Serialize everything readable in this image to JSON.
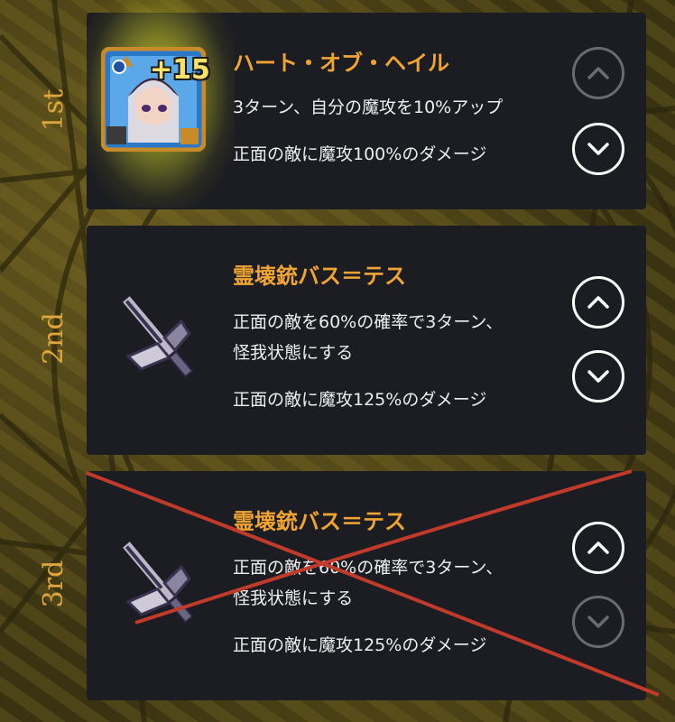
{
  "accent_color": "#f0a431",
  "rank_color": "#e0a63c",
  "cards": [
    {
      "rank": "1st",
      "title": "ハート・オブ・ヘイル",
      "line1": "3ターン、自分の魔攻を10%アップ",
      "line2": "",
      "line3": "正面の敵に魔攻100%のダメージ",
      "badge": "+15",
      "icon": "character-portrait-icon",
      "up_enabled": false,
      "down_enabled": true,
      "crossed_out": false
    },
    {
      "rank": "2nd",
      "title": "霊壊銃バス＝テス",
      "line1": "正面の敵を60%の確率で3ターン、",
      "line2": "怪我状態にする",
      "line3": "正面の敵に魔攻125%のダメージ",
      "icon": "axe-gun-weapon-icon",
      "up_enabled": true,
      "down_enabled": true,
      "crossed_out": false
    },
    {
      "rank": "3rd",
      "title": "霊壊銃バス＝テス",
      "line1": "正面の敵を60%の確率で3ターン、",
      "line2": "怪我状態にする",
      "line3": "正面の敵に魔攻125%のダメージ",
      "icon": "axe-gun-weapon-icon",
      "up_enabled": true,
      "down_enabled": false,
      "crossed_out": true
    }
  ]
}
